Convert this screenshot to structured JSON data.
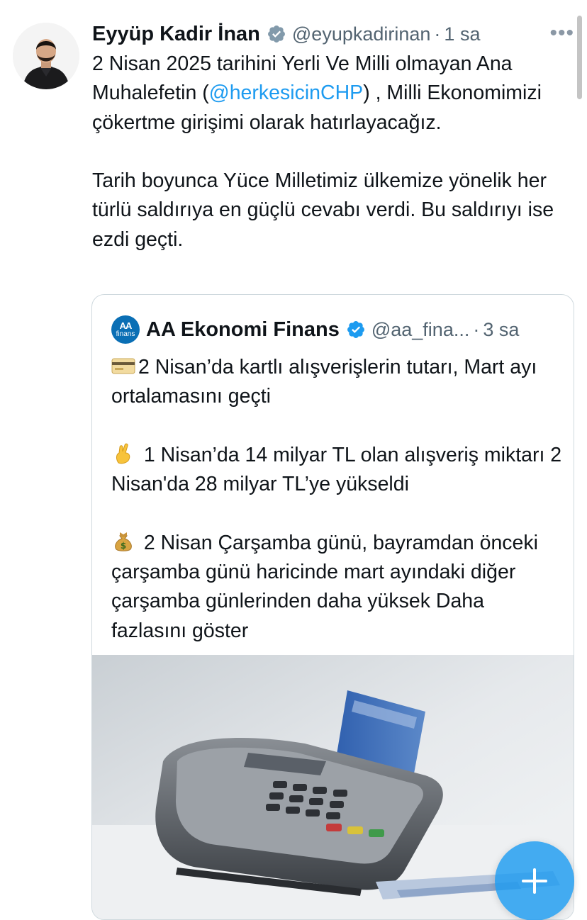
{
  "tweet": {
    "author_name": "Eyyüp Kadir İnan",
    "handle": "@eyupkadirinan",
    "separator": "·",
    "time": "1 sa",
    "text_before_mention": "2 Nisan 2025 tarihini Yerli Ve Milli olmayan Ana Muhalefetin (",
    "mention": "@herkesicinCHP",
    "text_after_mention": ") , Milli Ekonomimizi çökertme girişimi olarak hatırlayacağız.\n\nTarih boyunca Yüce Milletimiz ülkemize yönelik her türlü saldırıya en güçlü cevabı verdi. Bu saldırıyı ise ezdi geçti."
  },
  "quoted_tweet": {
    "avatar_text_top": "AA",
    "avatar_text_bottom": "finans",
    "author_name": "AA Ekonomi Finans",
    "handle": "@aa_fina...",
    "separator": "·",
    "time": "3 sa",
    "paragraphs": [
      {
        "emoji": "credit-card-emoji",
        "text": "2 Nisan’da kartlı alışverişlerin tutarı, Mart ayı ortalamasını geçti"
      },
      {
        "emoji": "crossed-fingers-emoji",
        "text": " 1 Nisan’da 14 milyar TL olan alışveriş miktarı 2 Nisan'da 28 milyar TL’ye yükseldi"
      },
      {
        "emoji": "money-bag-emoji",
        "text": " 2 Nisan Çarşamba günü, bayramdan önceki çarşamba günü haricinde mart ayındaki diğer çarşamba günlerinden daha yüksek Daha fazlasını göster"
      }
    ],
    "image_subject": "pos-terminal-with-credit-card"
  },
  "colors": {
    "link_blue": "#1d9bf0",
    "text_primary": "#0f1419",
    "text_secondary": "#536471",
    "border": "#cfd9de"
  },
  "icons": {
    "verified": "verified-badge-icon",
    "more": "more-options-icon",
    "compose": "plus-icon"
  }
}
